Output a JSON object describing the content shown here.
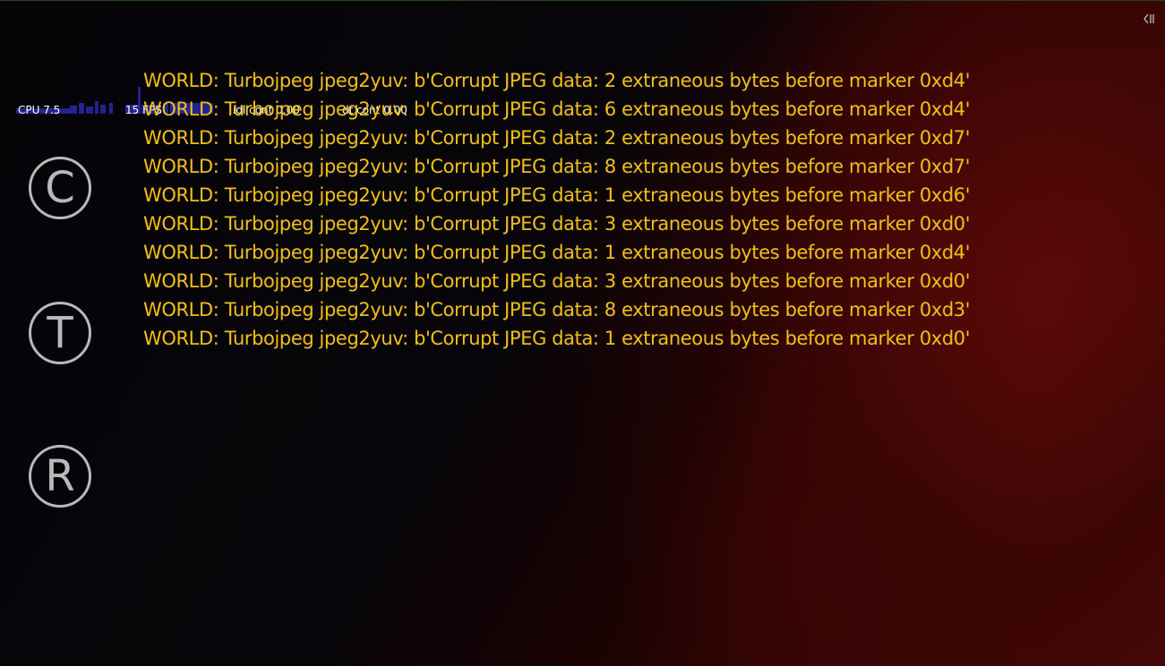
{
  "hud": {
    "cpu": "CPU 7.5",
    "fps": "15 FPS",
    "idl": "idl cont 0.00",
    "dt": "dt cont 0.00"
  },
  "buttons": {
    "c": "C",
    "t": "T",
    "r": "R"
  },
  "colors": {
    "log_text": "#f2c018",
    "button_outline": "#b9b9b9",
    "hud_bars": "#23238f",
    "background_red": "#4a0806"
  },
  "log": [
    "WORLD: Turbojpeg jpeg2yuv: b'Corrupt JPEG data: 2 extraneous bytes before marker 0xd4'",
    "WORLD: Turbojpeg jpeg2yuv: b'Corrupt JPEG data: 6 extraneous bytes before marker 0xd4'",
    "WORLD: Turbojpeg jpeg2yuv: b'Corrupt JPEG data: 2 extraneous bytes before marker 0xd7'",
    "WORLD: Turbojpeg jpeg2yuv: b'Corrupt JPEG data: 8 extraneous bytes before marker 0xd7'",
    "WORLD: Turbojpeg jpeg2yuv: b'Corrupt JPEG data: 1 extraneous bytes before marker 0xd6'",
    "WORLD: Turbojpeg jpeg2yuv: b'Corrupt JPEG data: 3 extraneous bytes before marker 0xd0'",
    "WORLD: Turbojpeg jpeg2yuv: b'Corrupt JPEG data: 1 extraneous bytes before marker 0xd4'",
    "WORLD: Turbojpeg jpeg2yuv: b'Corrupt JPEG data: 3 extraneous bytes before marker 0xd0'",
    "WORLD: Turbojpeg jpeg2yuv: b'Corrupt JPEG data: 8 extraneous bytes before marker 0xd3'",
    "WORLD: Turbojpeg jpeg2yuv: b'Corrupt JPEG data: 1 extraneous bytes before marker 0xd0'"
  ]
}
